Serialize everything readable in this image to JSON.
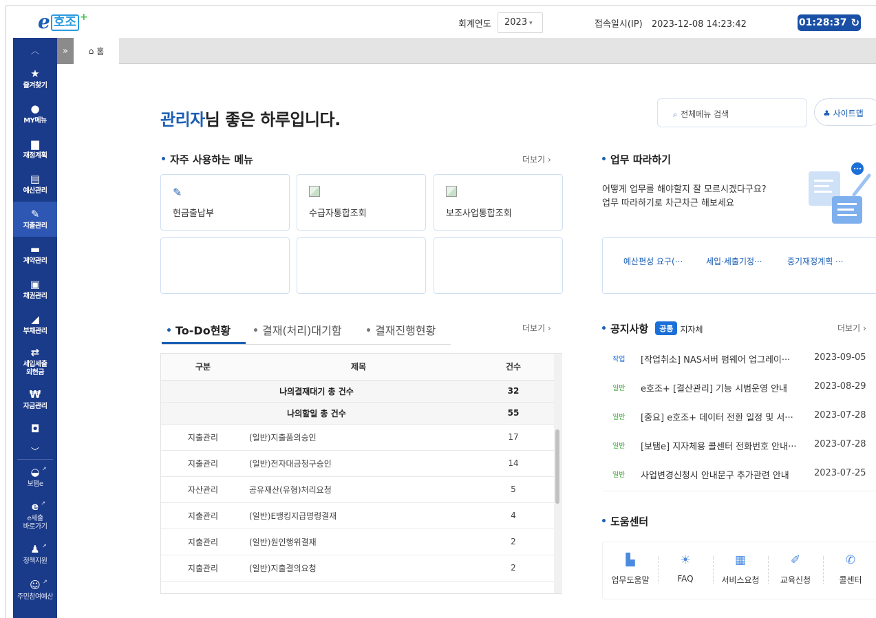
{
  "header": {
    "fiscal_year_label": "회계연도",
    "fiscal_year_value": "2023",
    "login_label": "접속일시(IP)",
    "login_value": "2023-12-08 14:23:42",
    "timer": "01:28:37"
  },
  "logo": {
    "e": "e",
    "ko": "호조",
    "plus": "+"
  },
  "sidebar": {
    "items": [
      {
        "label": "즐겨찾기",
        "icon": "star-icon",
        "glyph": "★"
      },
      {
        "label": "MY메뉴",
        "icon": "user-icon",
        "glyph": "●"
      },
      {
        "label": "재정계획",
        "icon": "briefcase-icon",
        "glyph": "▆"
      },
      {
        "label": "예산관리",
        "icon": "document-icon",
        "glyph": "▤"
      },
      {
        "label": "지출관리",
        "icon": "feather-icon",
        "glyph": "✎"
      },
      {
        "label": "계약관리",
        "icon": "card-icon",
        "glyph": "▬"
      },
      {
        "label": "채권관리",
        "icon": "receipt-icon",
        "glyph": "▣"
      },
      {
        "label": "부채관리",
        "icon": "send-icon",
        "glyph": "◢"
      },
      {
        "label": "세입세출\n외현금",
        "icon": "money-icon",
        "glyph": "⇄"
      },
      {
        "label": "자금관리",
        "icon": "won-icon",
        "glyph": "₩"
      },
      {
        "label": "",
        "icon": "bag-icon",
        "glyph": "◘"
      }
    ],
    "externals": [
      {
        "label": "보탬e",
        "icon": "shield-icon",
        "glyph": "◒"
      },
      {
        "label": "e세출\n바로가기",
        "icon": "e-icon",
        "glyph": "e"
      },
      {
        "label": "정책지원",
        "icon": "person-icon",
        "glyph": "♟"
      },
      {
        "label": "주민참여예산",
        "icon": "people-icon",
        "glyph": "☺"
      }
    ]
  },
  "tabbar": {
    "home_label": "홈"
  },
  "main": {
    "greet_name": "관리자",
    "greet_rest": "님 좋은 하루입니다.",
    "search_placeholder": "전체메뉴 검색",
    "sitemap_label": "사이트맵",
    "quick_title": "자주 사용하는 메뉴",
    "more_label": "더보기",
    "quick_items": [
      "현금출납부",
      "수급자통합조회",
      "보조사업통합조회"
    ],
    "todo_tabs": [
      "To-Do현황",
      "결재(처리)대기함",
      "결재진행현황"
    ],
    "todo_headers": [
      "구분",
      "제목",
      "건수"
    ],
    "todo_summary": [
      {
        "title": "나의결재대기 총 건수",
        "count": "32"
      },
      {
        "title": "나의할일 총 건수",
        "count": "55"
      }
    ],
    "todo_rows": [
      {
        "cat": "지출관리",
        "title": "(일반)지출품의승인",
        "count": "17"
      },
      {
        "cat": "지출관리",
        "title": "(일반)전자대금청구승인",
        "count": "14"
      },
      {
        "cat": "자산관리",
        "title": "공유재산(유형)처리요청",
        "count": "5"
      },
      {
        "cat": "지출관리",
        "title": "(일반)E뱅킹지급명령결재",
        "count": "4"
      },
      {
        "cat": "지출관리",
        "title": "(일반)원인행위결재",
        "count": "2"
      },
      {
        "cat": "지출관리",
        "title": "(일반)지출결의요청",
        "count": "2"
      }
    ]
  },
  "guide": {
    "title": "업무 따라하기",
    "line1": "어떻게 업무를 해야할지 잘 모르시겠다구요?",
    "line2": "업무 따라하기로 차근차근 해보세요",
    "links": [
      "예산편성 요구(···",
      "세입·세출기정···",
      "중기재정계획 ···"
    ]
  },
  "notice": {
    "title": "공지사항",
    "badge": "공통",
    "sub": "지자체",
    "items": [
      {
        "tag": "작업",
        "type": "work",
        "title": "[작업취소] NAS서버 펌웨어 업그레이···",
        "date": "2023-09-05"
      },
      {
        "tag": "일반",
        "type": "gen",
        "title": "e호조+ [결산관리] 기능 시범운영 안내",
        "date": "2023-08-29"
      },
      {
        "tag": "일반",
        "type": "gen",
        "title": "[중요] e호조+ 데이터 전환 일정 및 서···",
        "date": "2023-07-28"
      },
      {
        "tag": "일반",
        "type": "gen",
        "title": "[보탬e] 지자체용 콜센터 전화번호 안내···",
        "date": "2023-07-28"
      },
      {
        "tag": "일반",
        "type": "gen",
        "title": "사업변경신청시 안내문구 추가관련 안내",
        "date": "2023-07-25"
      }
    ]
  },
  "help": {
    "title": "도움센터",
    "items": [
      {
        "label": "업무도움말",
        "icon": "book-icon",
        "glyph": "▙"
      },
      {
        "label": "FAQ",
        "icon": "bulb-icon",
        "glyph": "☀"
      },
      {
        "label": "서비스요청",
        "icon": "chat-icon",
        "glyph": "▦"
      },
      {
        "label": "교육신청",
        "icon": "pen-icon",
        "glyph": "✐"
      },
      {
        "label": "콜센터",
        "icon": "phone-icon",
        "glyph": "✆"
      }
    ]
  },
  "colors": {
    "sidebar": "#1a3a8a",
    "accent": "#1b5fb4",
    "timer": "#1a4fa6"
  }
}
